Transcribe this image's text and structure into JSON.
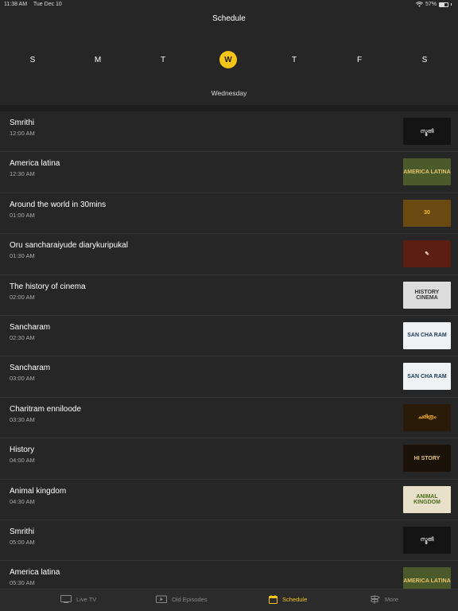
{
  "status": {
    "time": "11:38 AM",
    "date": "Tue Dec 10",
    "battery": "57%",
    "battery_level": 0.57
  },
  "header": {
    "title": "Schedule",
    "days": [
      "S",
      "M",
      "T",
      "W",
      "T",
      "F",
      "S"
    ],
    "selected_index": 3,
    "selected_day_name": "Wednesday"
  },
  "schedule": [
    {
      "title": "Smrithi",
      "time": "12:00 AM",
      "thumb_text": "സ്മൃതി",
      "thumb_bg": "#141414",
      "thumb_fg": "#cccccc"
    },
    {
      "title": "America latina",
      "time": "12:30 AM",
      "thumb_text": "AMERICA LATINA",
      "thumb_bg": "#4a5a2a",
      "thumb_fg": "#e6c36a"
    },
    {
      "title": "Around the world in 30mins",
      "time": "01:00 AM",
      "thumb_text": "30",
      "thumb_bg": "#6b4a12",
      "thumb_fg": "#f0c040"
    },
    {
      "title": "Oru sancharaiyude diarykuripukal",
      "time": "01:30 AM",
      "thumb_text": "✎",
      "thumb_bg": "#5a1e12",
      "thumb_fg": "#e8d0b0"
    },
    {
      "title": "The history of cinema",
      "time": "02:00 AM",
      "thumb_text": "HISTORY CINEMA",
      "thumb_bg": "#dcdcdc",
      "thumb_fg": "#333333"
    },
    {
      "title": "Sancharam",
      "time": "02:30 AM",
      "thumb_text": "SAN CHA RAM",
      "thumb_bg": "#eef2f4",
      "thumb_fg": "#1a3a5a"
    },
    {
      "title": "Sancharam",
      "time": "03:00 AM",
      "thumb_text": "SAN CHA RAM",
      "thumb_bg": "#eef2f4",
      "thumb_fg": "#1a3a5a"
    },
    {
      "title": "Charitram enniloode",
      "time": "03:30 AM",
      "thumb_text": "ചരിത്രം",
      "thumb_bg": "#2a1a08",
      "thumb_fg": "#e8a830"
    },
    {
      "title": "History",
      "time": "04:00 AM",
      "thumb_text": "HI STORY",
      "thumb_bg": "#1a1208",
      "thumb_fg": "#e0c080"
    },
    {
      "title": "Animal kingdom",
      "time": "04:30 AM",
      "thumb_text": "ANIMAL KINGDOM",
      "thumb_bg": "#e8e0c8",
      "thumb_fg": "#4a6a1a"
    },
    {
      "title": "Smrithi",
      "time": "05:00 AM",
      "thumb_text": "സ്മൃതി",
      "thumb_bg": "#141414",
      "thumb_fg": "#cccccc"
    },
    {
      "title": "America latina",
      "time": "05:30 AM",
      "thumb_text": "AMERICA LATINA",
      "thumb_bg": "#4a5a2a",
      "thumb_fg": "#e6c36a"
    }
  ],
  "tabs": [
    {
      "label": "Live TV",
      "icon": "tv-icon"
    },
    {
      "label": "Old Episodes",
      "icon": "play-icon"
    },
    {
      "label": "Schedule",
      "icon": "calendar-icon"
    },
    {
      "label": "More",
      "icon": "signpost-icon"
    }
  ],
  "active_tab": 2,
  "colors": {
    "accent": "#f5c518",
    "background": "#262626"
  }
}
